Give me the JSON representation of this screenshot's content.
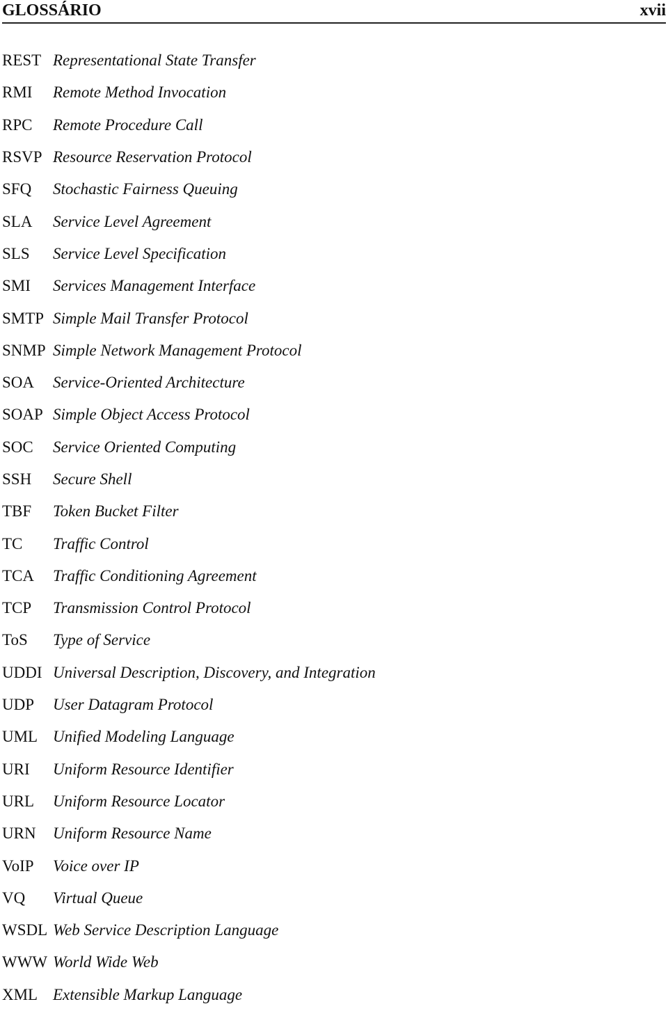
{
  "header": {
    "title": "GLOSSÁRIO",
    "page_number": "xvii"
  },
  "entries": [
    {
      "abbr": "REST",
      "definition": "Representational State Transfer"
    },
    {
      "abbr": "RMI",
      "definition": "Remote Method Invocation"
    },
    {
      "abbr": "RPC",
      "definition": "Remote Procedure Call"
    },
    {
      "abbr": "RSVP",
      "definition": "Resource Reservation Protocol"
    },
    {
      "abbr": "SFQ",
      "definition": "Stochastic Fairness Queuing"
    },
    {
      "abbr": "SLA",
      "definition": "Service Level Agreement"
    },
    {
      "abbr": "SLS",
      "definition": "Service Level Specification"
    },
    {
      "abbr": "SMI",
      "definition": "Services Management Interface"
    },
    {
      "abbr": "SMTP",
      "definition": "Simple Mail Transfer Protocol"
    },
    {
      "abbr": "SNMP",
      "definition": "Simple Network Management Protocol"
    },
    {
      "abbr": "SOA",
      "definition": "Service-Oriented Architecture"
    },
    {
      "abbr": "SOAP",
      "definition": "Simple Object Access Protocol"
    },
    {
      "abbr": "SOC",
      "definition": "Service Oriented Computing"
    },
    {
      "abbr": "SSH",
      "definition": "Secure Shell"
    },
    {
      "abbr": "TBF",
      "definition": "Token Bucket Filter"
    },
    {
      "abbr": "TC",
      "definition": "Traffic Control"
    },
    {
      "abbr": "TCA",
      "definition": "Traffic Conditioning Agreement"
    },
    {
      "abbr": "TCP",
      "definition": "Transmission Control Protocol"
    },
    {
      "abbr": "ToS",
      "definition": "Type of Service"
    },
    {
      "abbr": "UDDI",
      "definition": "Universal Description, Discovery, and Integration"
    },
    {
      "abbr": "UDP",
      "definition": "User Datagram Protocol"
    },
    {
      "abbr": "UML",
      "definition": "Unified Modeling Language"
    },
    {
      "abbr": "URI",
      "definition": "Uniform Resource Identifier"
    },
    {
      "abbr": "URL",
      "definition": "Uniform Resource Locator"
    },
    {
      "abbr": "URN",
      "definition": "Uniform Resource Name"
    },
    {
      "abbr": "VoIP",
      "definition": "Voice over IP"
    },
    {
      "abbr": "VQ",
      "definition": "Virtual Queue"
    },
    {
      "abbr": "WSDL",
      "definition": "Web Service Description Language"
    },
    {
      "abbr": "WWW",
      "definition": "World Wide Web"
    },
    {
      "abbr": "XML",
      "definition": "Extensible Markup Language"
    }
  ]
}
